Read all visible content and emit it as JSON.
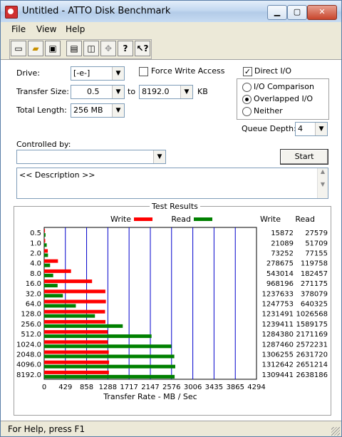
{
  "window": {
    "title": "Untitled - ATTO Disk Benchmark"
  },
  "menu": {
    "file": "File",
    "view": "View",
    "help": "Help"
  },
  "toolbar": {
    "icons": [
      "new-icon",
      "open-icon",
      "save-icon",
      "print-icon",
      "print-preview-icon",
      "move-icon",
      "help-icon",
      "context-help-icon"
    ]
  },
  "form": {
    "drive_label": "Drive:",
    "drive_value": "[-e-]",
    "force_write_label": "Force Write Access",
    "force_write_checked": false,
    "direct_io_label": "Direct I/O",
    "direct_io_checked": true,
    "transfer_size_label": "Transfer Size:",
    "transfer_from": "0.5",
    "to_label": "to",
    "transfer_to": "8192.0",
    "kb_label": "KB",
    "total_length_label": "Total Length:",
    "total_length": "256 MB",
    "io_mode": {
      "options": [
        "I/O Comparison",
        "Overlapped I/O",
        "Neither"
      ],
      "selected": "Overlapped I/O"
    },
    "queue_depth_label": "Queue Depth:",
    "queue_depth": "4",
    "controlled_by_label": "Controlled by:",
    "controlled_by_value": "",
    "start_label": "Start",
    "description": "<< Description >>"
  },
  "results": {
    "title": "Test Results"
  },
  "chart_data": {
    "type": "bar",
    "title": "Test Results",
    "xlabel": "Transfer Rate - MB / Sec",
    "ylabel": "",
    "categories": [
      "0.5",
      "1.0",
      "2.0",
      "4.0",
      "8.0",
      "16.0",
      "32.0",
      "64.0",
      "128.0",
      "256.0",
      "512.0",
      "1024.0",
      "2048.0",
      "4096.0",
      "8192.0"
    ],
    "series": [
      {
        "name": "Write",
        "color": "#ff0000",
        "values": [
          15872,
          21089,
          73252,
          278675,
          543014,
          968196,
          1237633,
          1247753,
          1231491,
          1239411,
          1284380,
          1287460,
          1306255,
          1312642,
          1309441
        ]
      },
      {
        "name": "Read",
        "color": "#008000",
        "values": [
          27579,
          51709,
          77155,
          119758,
          182457,
          271175,
          378079,
          640325,
          1026568,
          1589175,
          2171169,
          2572231,
          2631720,
          2651214,
          2638186
        ]
      }
    ],
    "bar_unit_divisor": 1000,
    "xticks": [
      "0",
      "429",
      "858",
      "1288",
      "1717",
      "2147",
      "2576",
      "3006",
      "3435",
      "3865",
      "4294"
    ],
    "xlim": [
      0,
      4294
    ],
    "column_headers": {
      "write": "Write",
      "read": "Read"
    },
    "legend": "top"
  },
  "status": {
    "text": "For Help, press F1"
  }
}
